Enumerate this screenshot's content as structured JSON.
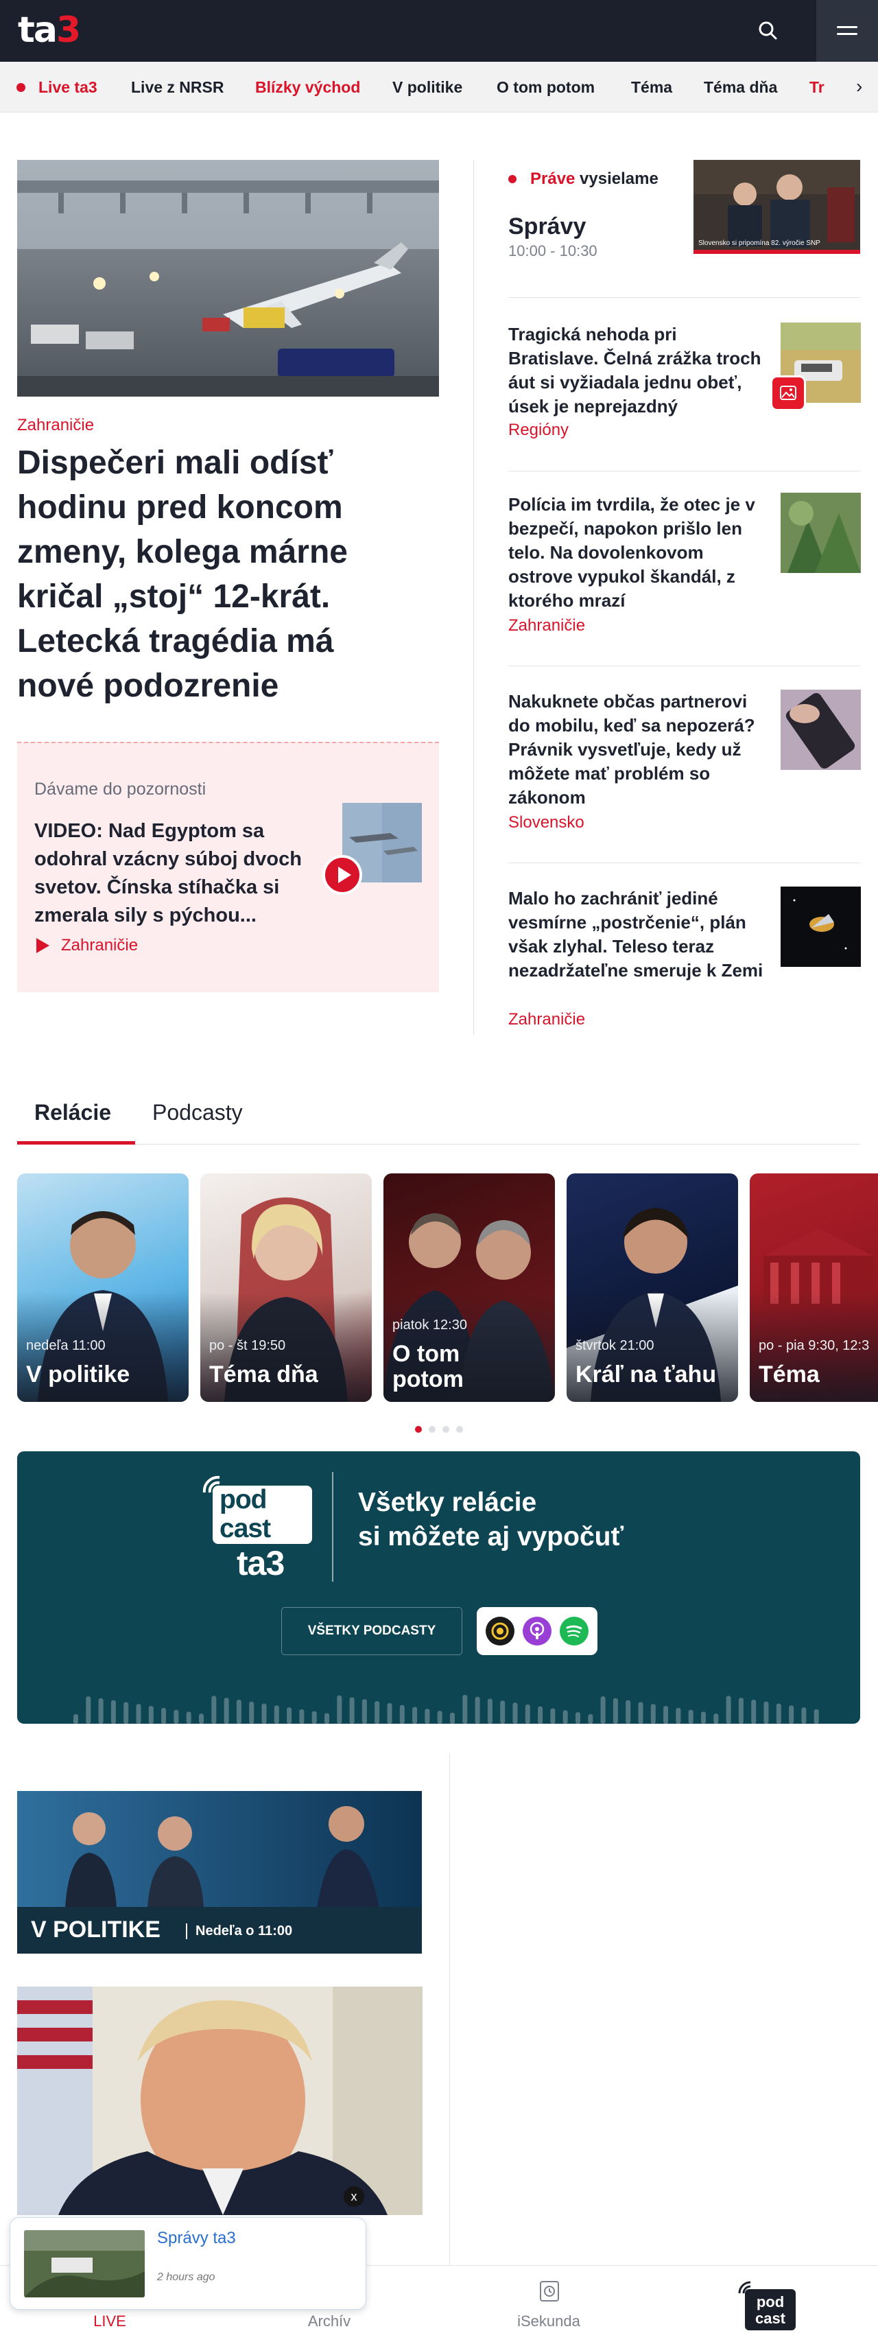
{
  "header": {
    "logo_main": "ta",
    "logo_accent": "3",
    "search_icon": "search-icon",
    "menu_icon": "hamburger-menu-icon"
  },
  "nav": {
    "items": [
      {
        "label": "Live ta3",
        "highlight": true
      },
      {
        "label": "Live z NRSR",
        "highlight": false
      },
      {
        "label": "Blízky východ",
        "highlight": true
      },
      {
        "label": "V politike",
        "highlight": false
      },
      {
        "label": "O tom potom",
        "highlight": false
      },
      {
        "label": "Téma",
        "highlight": false
      },
      {
        "label": "Téma dňa",
        "highlight": false
      },
      {
        "label": "Tr",
        "highlight": true
      }
    ],
    "more_icon": "chevron-right-icon"
  },
  "lead": {
    "category": "Zahraničie",
    "title": "Dispečeri mali odísť hodinu pred koncom zmeny, kolega márne kričal „stoj“ 12-krát. Letecká tragédia má nové podozrenie"
  },
  "promo": {
    "label": "Dávame do pozornosti",
    "title": "VIDEO: Nad Egyptom sa odohral vzácny súboj dvoch svetov. Čínska stíhačka si zmerala sily s pýchou...",
    "category": "Zahraničie"
  },
  "live": {
    "prefix": "Práve",
    "suffix": " vysielame",
    "show": "Správy",
    "time": "10:00 - 10:30",
    "thumb_caption": "Slovensko si pripomína 82. výročie SNP"
  },
  "side_stories": [
    {
      "title": "Tragická nehoda pri Bratislave. Čelná zrážka troch áut si vyžiadala jednu obeť, úsek je neprejazdný",
      "category": "Regióny"
    },
    {
      "title": "Polícia im tvrdila, že otec je v bezpečí, napokon prišlo len telo. Na dovolenkovom ostrove vypukol škandál, z ktorého mrazí",
      "category": "Zahraničie"
    },
    {
      "title": "Nakuknete občas partnerovi do mobilu, keď sa nepozerá? Právnik vysvetľuje, kedy už môžete mať problém so zákonom",
      "category": "Slovensko"
    },
    {
      "title": "Malo ho zachrániť jediné vesmírne „postrčenie“, plán však zlyhal. Teleso teraz nezadržateľne smeruje k Zemi",
      "category": "Zahraničie"
    }
  ],
  "tabs": [
    {
      "label": "Relácie",
      "active": true
    },
    {
      "label": "Podcasty",
      "active": false
    }
  ],
  "shows": [
    {
      "schedule": "nedeľa 11:00",
      "name": "V politike"
    },
    {
      "schedule": "po - št 19:50",
      "name": "Téma dňa"
    },
    {
      "schedule": "piatok 12:30",
      "name": "O tom potom"
    },
    {
      "schedule": "štvrtok 21:00",
      "name": "Kráľ na ťahu"
    },
    {
      "schedule": "po - pia 9:30, 12:3",
      "name": "Téma"
    }
  ],
  "carousel": {
    "pages": 4,
    "active_page": 1
  },
  "podcast_banner": {
    "logo_top": "pod\ncast",
    "logo_bottom": "ta3",
    "headline": "Všetky relácie\nsi môžete aj vypočuť",
    "button": "VŠETKY PODCASTY",
    "apps": [
      "pocket-casts-icon",
      "apple-podcasts-icon",
      "spotify-icon"
    ]
  },
  "vpolitike_banner": {
    "title": "V POLITIKE",
    "subtitle": "Nedeľa o 11:00"
  },
  "close_label": "x",
  "toast": {
    "title": "Správy ta3",
    "time": "2 hours ago"
  },
  "bottom_nav": [
    {
      "label": "LIVE",
      "icon": "live-icon",
      "active": true
    },
    {
      "label": "Archív",
      "icon": "archive-icon",
      "active": false
    },
    {
      "label": "iSekunda",
      "icon": "isekunda-icon",
      "active": false
    },
    {
      "label": "",
      "icon": "podcast-logo-icon",
      "active": false
    }
  ],
  "colors": {
    "brand_red": "#d9142a",
    "header_bg": "#1c202c",
    "podcast_bg": "#0e4553"
  }
}
